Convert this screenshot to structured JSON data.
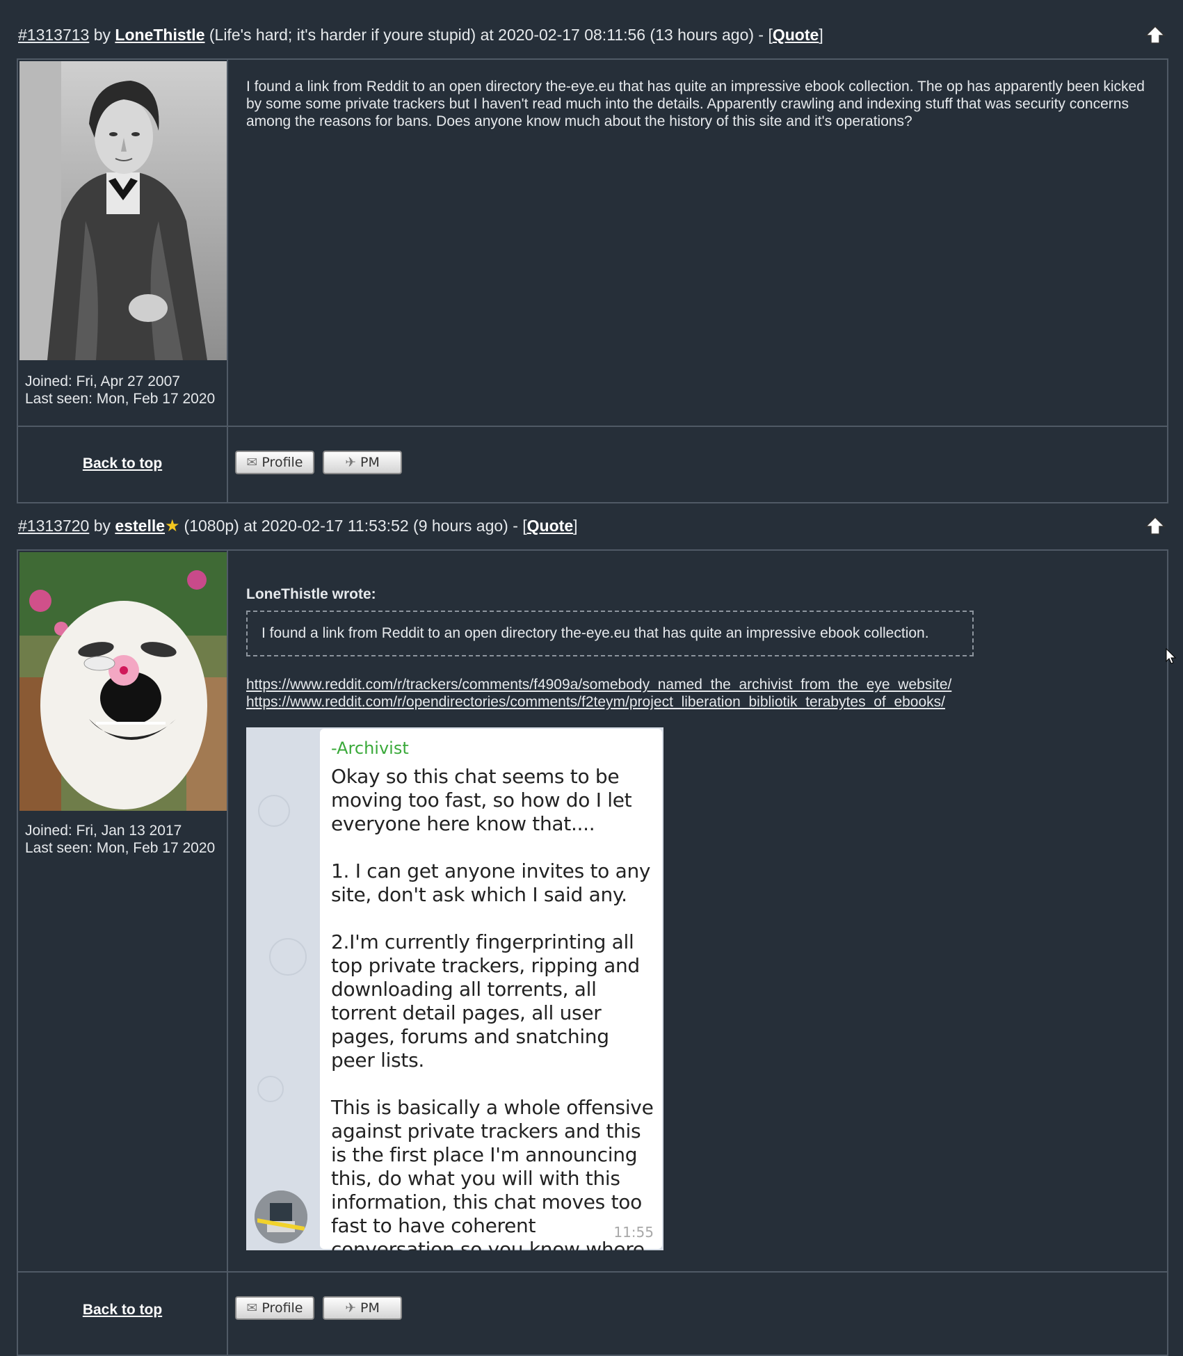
{
  "posts": [
    {
      "number": "#1313713",
      "by": "by",
      "username": "LoneThistle",
      "user_title": "(Life's hard; it's harder if youre stupid) at 2020-02-17 08:11:56 (13 hours ago) - ",
      "quote_label": "Quote",
      "joined": "Joined: Fri, Apr 27 2007",
      "last_seen": "Last seen: Mon, Feb 17 2020",
      "body": "I found a link from Reddit to an open directory the-eye.eu that has quite an impressive ebook collection. The op has apparently been kicked by some some private trackers but I haven't read much into the details. Apparently crawling and indexing stuff that was security concerns among the reasons for bans. Does anyone know much about the history of this site and it's operations?",
      "back_to_top": "Back to top",
      "profile_label": "Profile",
      "pm_label": "PM"
    },
    {
      "number": "#1313720",
      "by": "by",
      "username": "estelle",
      "user_title": "(1080p) at 2020-02-17 11:53:52 (9 hours ago) - ",
      "quote_label": "Quote",
      "joined": "Joined: Fri, Jan 13 2017",
      "last_seen": "Last seen: Mon, Feb 17 2020",
      "quote_author": "LoneThistle wrote:",
      "quoted_text": "I found a link from Reddit to an open directory the-eye.eu that has quite an impressive ebook collection.",
      "links": [
        "https://www.reddit.com/r/trackers/comments/f4909a/somebody_named_the_archivist_from_the_eye_website/",
        "https://www.reddit.com/r/opendirectories/comments/f2teym/project_liberation_bibliotik_terabytes_of_ebooks/"
      ],
      "chat": {
        "sender": "-Archivist",
        "text": "Okay so this chat seems to be moving too fast, so how do I let everyone here know that....\n\n1. I can get anyone invites to any site, don't ask which I said any.\n\n2.I'm currently fingerprinting all top private trackers, ripping and downloading all torrents, all torrent detail pages, all user pages, forums and snatching peer lists.\n\nThis is basically a whole offensive against private trackers and this is the first place I'm announcing this, do what you will with this information, this chat moves too fast to have coherent conversation so you know where to find me.",
        "time": "11:55"
      },
      "back_to_top": "Back to top",
      "profile_label": "Profile",
      "pm_label": "PM"
    }
  ],
  "colors": {
    "background": "#262f39",
    "border": "#505a66",
    "text": "#e6e9ec",
    "chat_sender": "#3aa93a"
  }
}
